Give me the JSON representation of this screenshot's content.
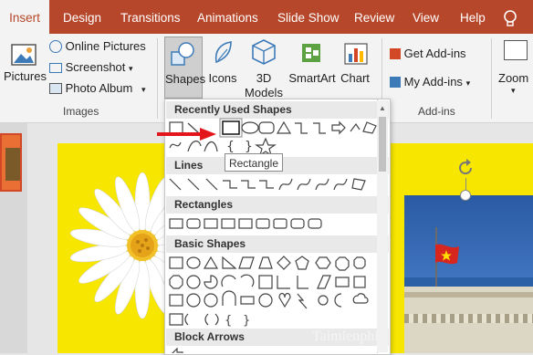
{
  "tabs": [
    {
      "label": "Insert",
      "active": true
    },
    {
      "label": "Design"
    },
    {
      "label": "Transitions"
    },
    {
      "label": "Animations"
    },
    {
      "label": "Slide Show"
    },
    {
      "label": "Review"
    },
    {
      "label": "View"
    },
    {
      "label": "Help"
    }
  ],
  "images_group": {
    "pictures": "Pictures",
    "online_pictures": "Online Pictures",
    "screenshot": "Screenshot",
    "photo_album": "Photo Album",
    "label": "Images"
  },
  "illustrations": {
    "shapes": "Shapes",
    "icons": "Icons",
    "models_3d": "3D",
    "models_3d_line2": "Models",
    "smartart": "SmartArt",
    "chart": "Chart"
  },
  "addins": {
    "get_addins": "Get Add-ins",
    "my_addins": "My Add-ins",
    "label": "Add-ins"
  },
  "zoom": "Zoom",
  "gallery": {
    "recently_used": "Recently Used Shapes",
    "lines": "Lines",
    "rectangles": "Rectangles",
    "basic_shapes": "Basic Shapes",
    "block_arrows": "Block Arrows"
  },
  "tooltip": "Rectangle",
  "watermark": "Taimienphi",
  "colors": {
    "accent": "#b7472a",
    "slide": "#f6e600"
  }
}
